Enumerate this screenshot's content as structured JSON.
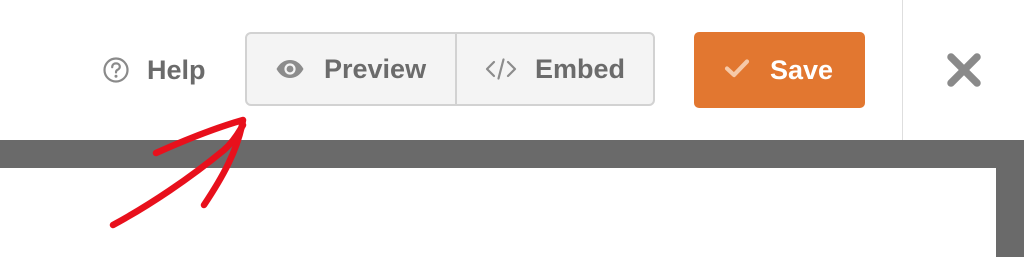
{
  "toolbar": {
    "help_label": "Help",
    "preview_label": "Preview",
    "embed_label": "Embed",
    "save_label": "Save"
  },
  "icons": {
    "help": "question-circle-icon",
    "preview": "eye-icon",
    "embed": "code-icon",
    "save": "checkmark-icon",
    "close": "close-icon"
  },
  "colors": {
    "save_button": "#e27730",
    "annotation_arrow": "#e8101c",
    "canvas_background": "#6a6a6a"
  }
}
